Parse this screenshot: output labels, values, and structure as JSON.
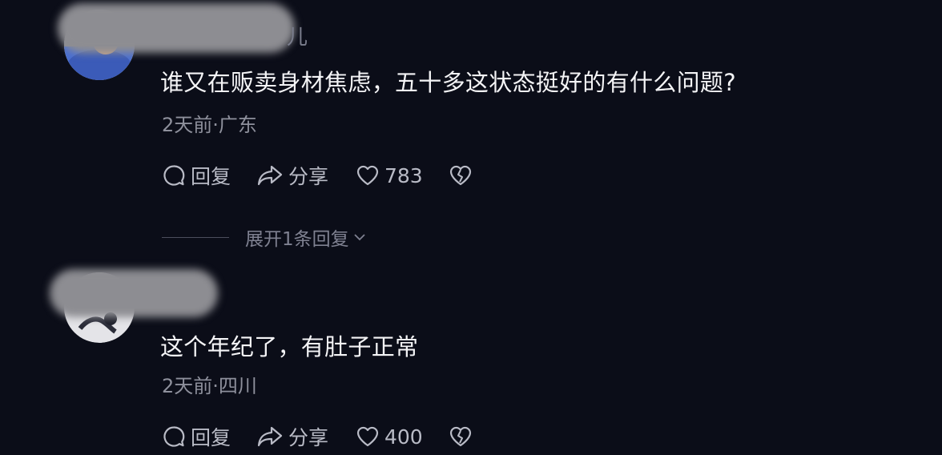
{
  "comments": [
    {
      "name_visible_tail": "儿",
      "text": "谁又在贩卖身材焦虑，五十多这状态挺好的有什么问题?",
      "meta": "2天前·广东",
      "actions": {
        "reply": "回复",
        "share": "分享",
        "likes": "783"
      }
    },
    {
      "text": "这个年纪了，有肚子正常",
      "meta": "2天前·四川",
      "actions": {
        "reply": "回复",
        "share": "分享",
        "likes": "400"
      }
    }
  ],
  "expand_replies": "展开1条回复",
  "icons": {
    "reply": "comment-bubble-icon",
    "share": "share-arrow-icon",
    "like": "heart-icon",
    "dislike": "broken-heart-icon",
    "expand": "chevron-down-icon"
  },
  "colors": {
    "background": "#0b0d18",
    "text": "#f4f4f6",
    "meta": "#8e909c",
    "action": "#b9bbc6"
  }
}
